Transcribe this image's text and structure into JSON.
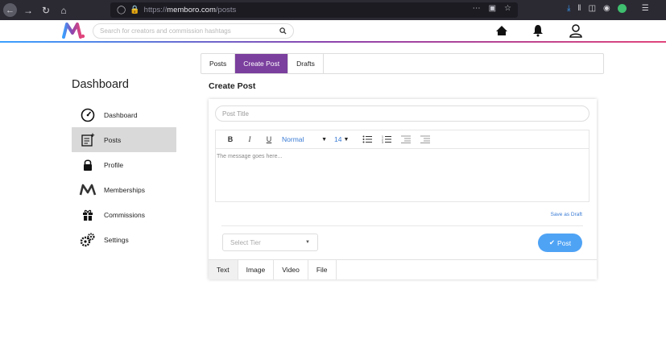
{
  "browser": {
    "url_prefix": "https://",
    "url_domain": "memboro.com",
    "url_path": "/posts"
  },
  "header": {
    "search_placeholder": "Search for creators and commission hashtags",
    "icons": [
      "home-icon",
      "bell-icon",
      "user-icon"
    ]
  },
  "sidebar": {
    "title": "Dashboard",
    "items": [
      {
        "label": "Dashboard",
        "icon": "speedometer-icon"
      },
      {
        "label": "Posts",
        "icon": "note-add-icon"
      },
      {
        "label": "Profile",
        "icon": "lock-icon"
      },
      {
        "label": "Memberships",
        "icon": "memboro-m-icon"
      },
      {
        "label": "Commissions",
        "icon": "gift-icon"
      },
      {
        "label": "Settings",
        "icon": "gears-icon"
      }
    ],
    "active_index": 1
  },
  "tabs": {
    "items": [
      "Posts",
      "Create Post",
      "Drafts"
    ],
    "active_index": 1
  },
  "create_post": {
    "title": "Create Post",
    "post_title_placeholder": "Post Title",
    "toolbar": {
      "bold": "B",
      "italic": "I",
      "underline": "U",
      "paragraph_style": "Normal",
      "font_size": "14"
    },
    "editor_placeholder": "The message goes here...",
    "save_draft": "Save as Draft",
    "tier_placeholder": "Select Tier",
    "post_button": "Post",
    "content_tabs": [
      "Text",
      "Image",
      "Video",
      "File"
    ],
    "active_content_tab": 0
  },
  "colors": {
    "accent_purple": "#7b3f9e",
    "post_button_blue": "#4fa3f5",
    "link_blue": "#3a7bd5"
  }
}
